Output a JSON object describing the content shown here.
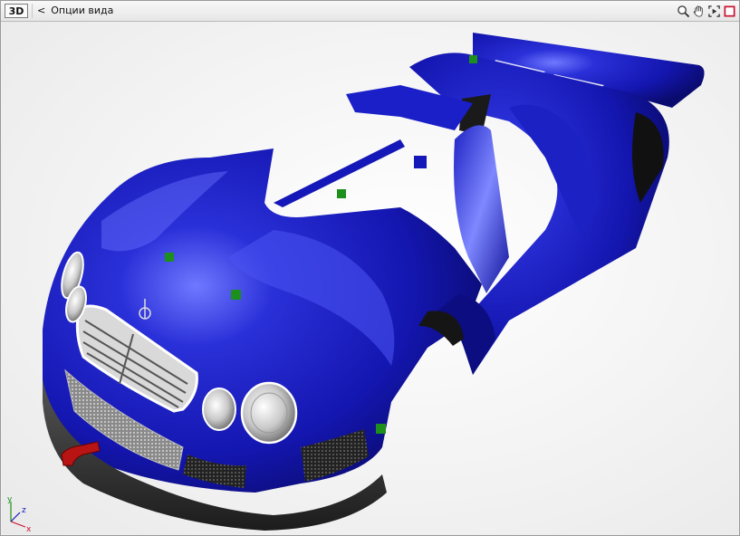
{
  "toolbar": {
    "mode_button": "3D",
    "back_chevron": "<",
    "view_options_label": "Опции вида",
    "tools": [
      {
        "name": "zoom-icon"
      },
      {
        "name": "pan-hand-icon"
      },
      {
        "name": "fit-view-icon"
      },
      {
        "name": "maximize-icon"
      }
    ]
  },
  "viewport": {
    "model": "car-body-shell",
    "body_color": "#1518b8",
    "marker_color": "#1c8f1c",
    "gizmo": {
      "axis_x": "x",
      "axis_y": "y",
      "axis_z": "z"
    }
  }
}
